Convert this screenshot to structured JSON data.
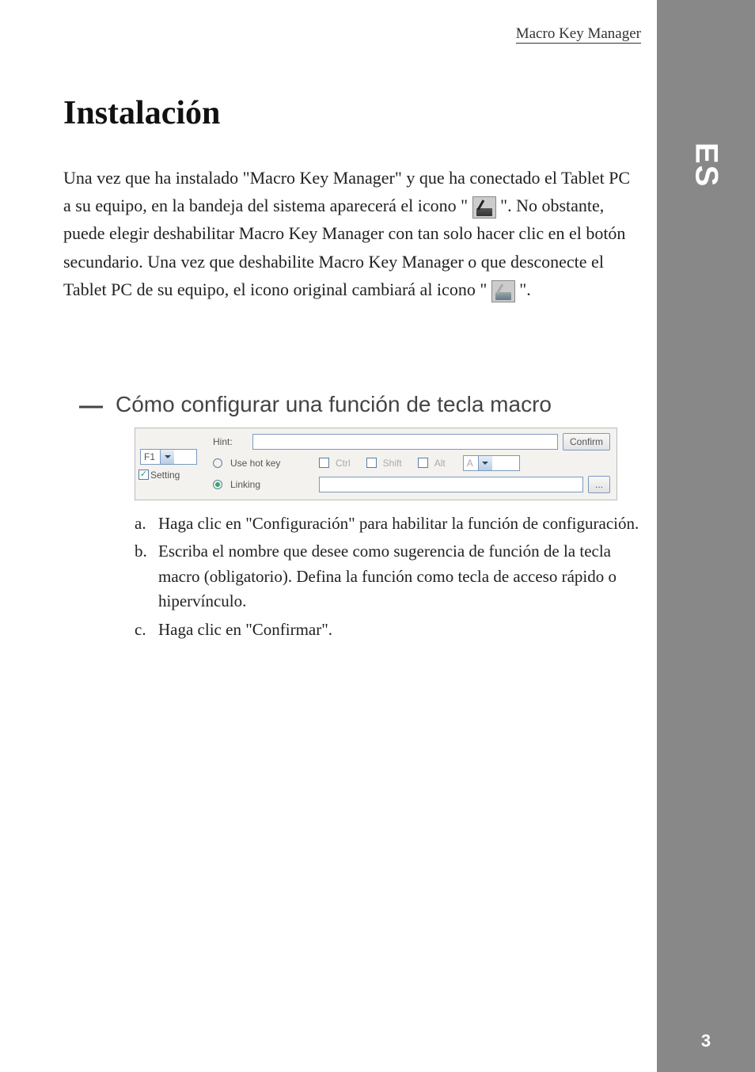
{
  "header": {
    "product": "Macro Key Manager"
  },
  "sidebar": {
    "lang": "ES",
    "page_number": "3"
  },
  "title": "Instalación",
  "intro": {
    "p1a": "Una vez que ha instalado \"Macro Key Manager\" y que ha conectado el Tablet PC a su equipo, en la bandeja del sistema aparecerá el icono \" ",
    "p1b": " \". No obstante, puede elegir deshabilitar Macro Key Manager con tan solo hacer clic en el botón secundario. Una vez que deshabilite Macro Key Manager o que desconecte el Tablet PC de su equipo, el icono original cambiará al icono \"",
    "p1c": "\"."
  },
  "section": {
    "bullet": "—",
    "title": "Cómo configurar una función de tecla macro"
  },
  "screenshot": {
    "key_select": "F1",
    "setting": "Setting",
    "hint": "Hint:",
    "confirm": "Confirm",
    "use_hot_key": "Use hot key",
    "ctrl": "Ctrl",
    "shift": "Shift",
    "alt": "Alt",
    "key_letter": "A",
    "linking": "Linking",
    "browse": "..."
  },
  "steps": {
    "a": {
      "label": "a.",
      "text": "Haga clic en \"Configuración\" para habilitar la función de configuración."
    },
    "b": {
      "label": "b.",
      "text": "Escriba el nombre que desee como sugerencia de función de la tecla macro (obligatorio). Defina la función como tecla de acceso rápido o hipervínculo."
    },
    "c": {
      "label": "c.",
      "text": "Haga clic en \"Confirmar\"."
    }
  }
}
